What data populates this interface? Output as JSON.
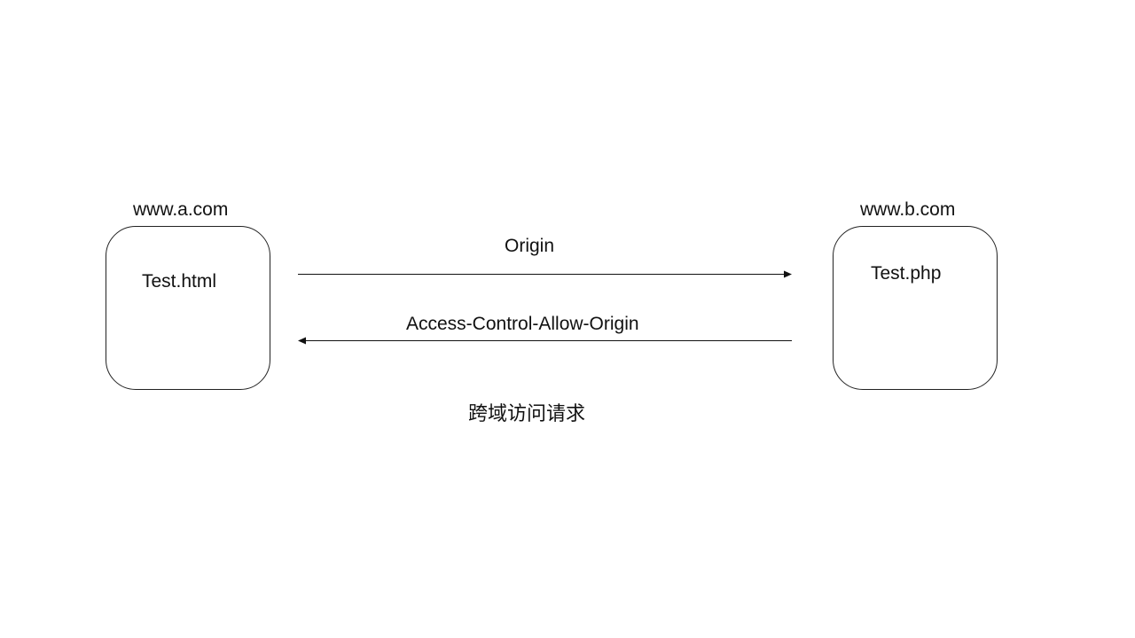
{
  "nodes": {
    "client": {
      "domain": "www.a.com",
      "file": "Test.html"
    },
    "server": {
      "domain": "www.b.com",
      "file": "Test.php"
    }
  },
  "edges": {
    "request": {
      "label": "Origin"
    },
    "response": {
      "label": "Access-Control-Allow-Origin"
    }
  },
  "caption": "跨域访问请求"
}
